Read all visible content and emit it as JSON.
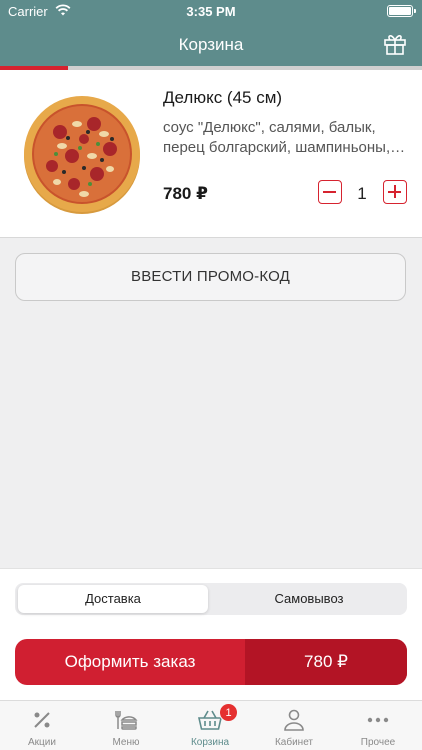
{
  "status_bar": {
    "carrier": "Carrier",
    "time": "3:35 PM"
  },
  "header": {
    "title": "Корзина",
    "icon": "gift-icon"
  },
  "progress": {
    "fraction": 0.16,
    "color": "#d6232f"
  },
  "cart": {
    "items": [
      {
        "name": "Делюкс (45 см)",
        "desc_line1": "соус \"Делюкс\", салями, балык,",
        "desc_line2": "перец болгарский, шампиньоны, томаты",
        "price": "780 ₽",
        "quantity": "1"
      }
    ]
  },
  "promo": {
    "label": "ВВЕСТИ ПРОМО-КОД"
  },
  "delivery_mode": {
    "options": [
      "Доставка",
      "Самовывоз"
    ],
    "selected": "Доставка"
  },
  "order": {
    "label": "Оформить заказ",
    "total": "780 ₽"
  },
  "tabbar": {
    "tabs": [
      {
        "label": "Акции",
        "icon": "percent-icon"
      },
      {
        "label": "Меню",
        "icon": "menu-food-icon"
      },
      {
        "label": "Корзина",
        "icon": "basket-icon",
        "badge": "1",
        "active": true
      },
      {
        "label": "Кабинет",
        "icon": "user-icon"
      },
      {
        "label": "Прочее",
        "icon": "more-icon"
      }
    ]
  },
  "colors": {
    "header": "#5e8c8c",
    "accent": "#d01f31"
  }
}
